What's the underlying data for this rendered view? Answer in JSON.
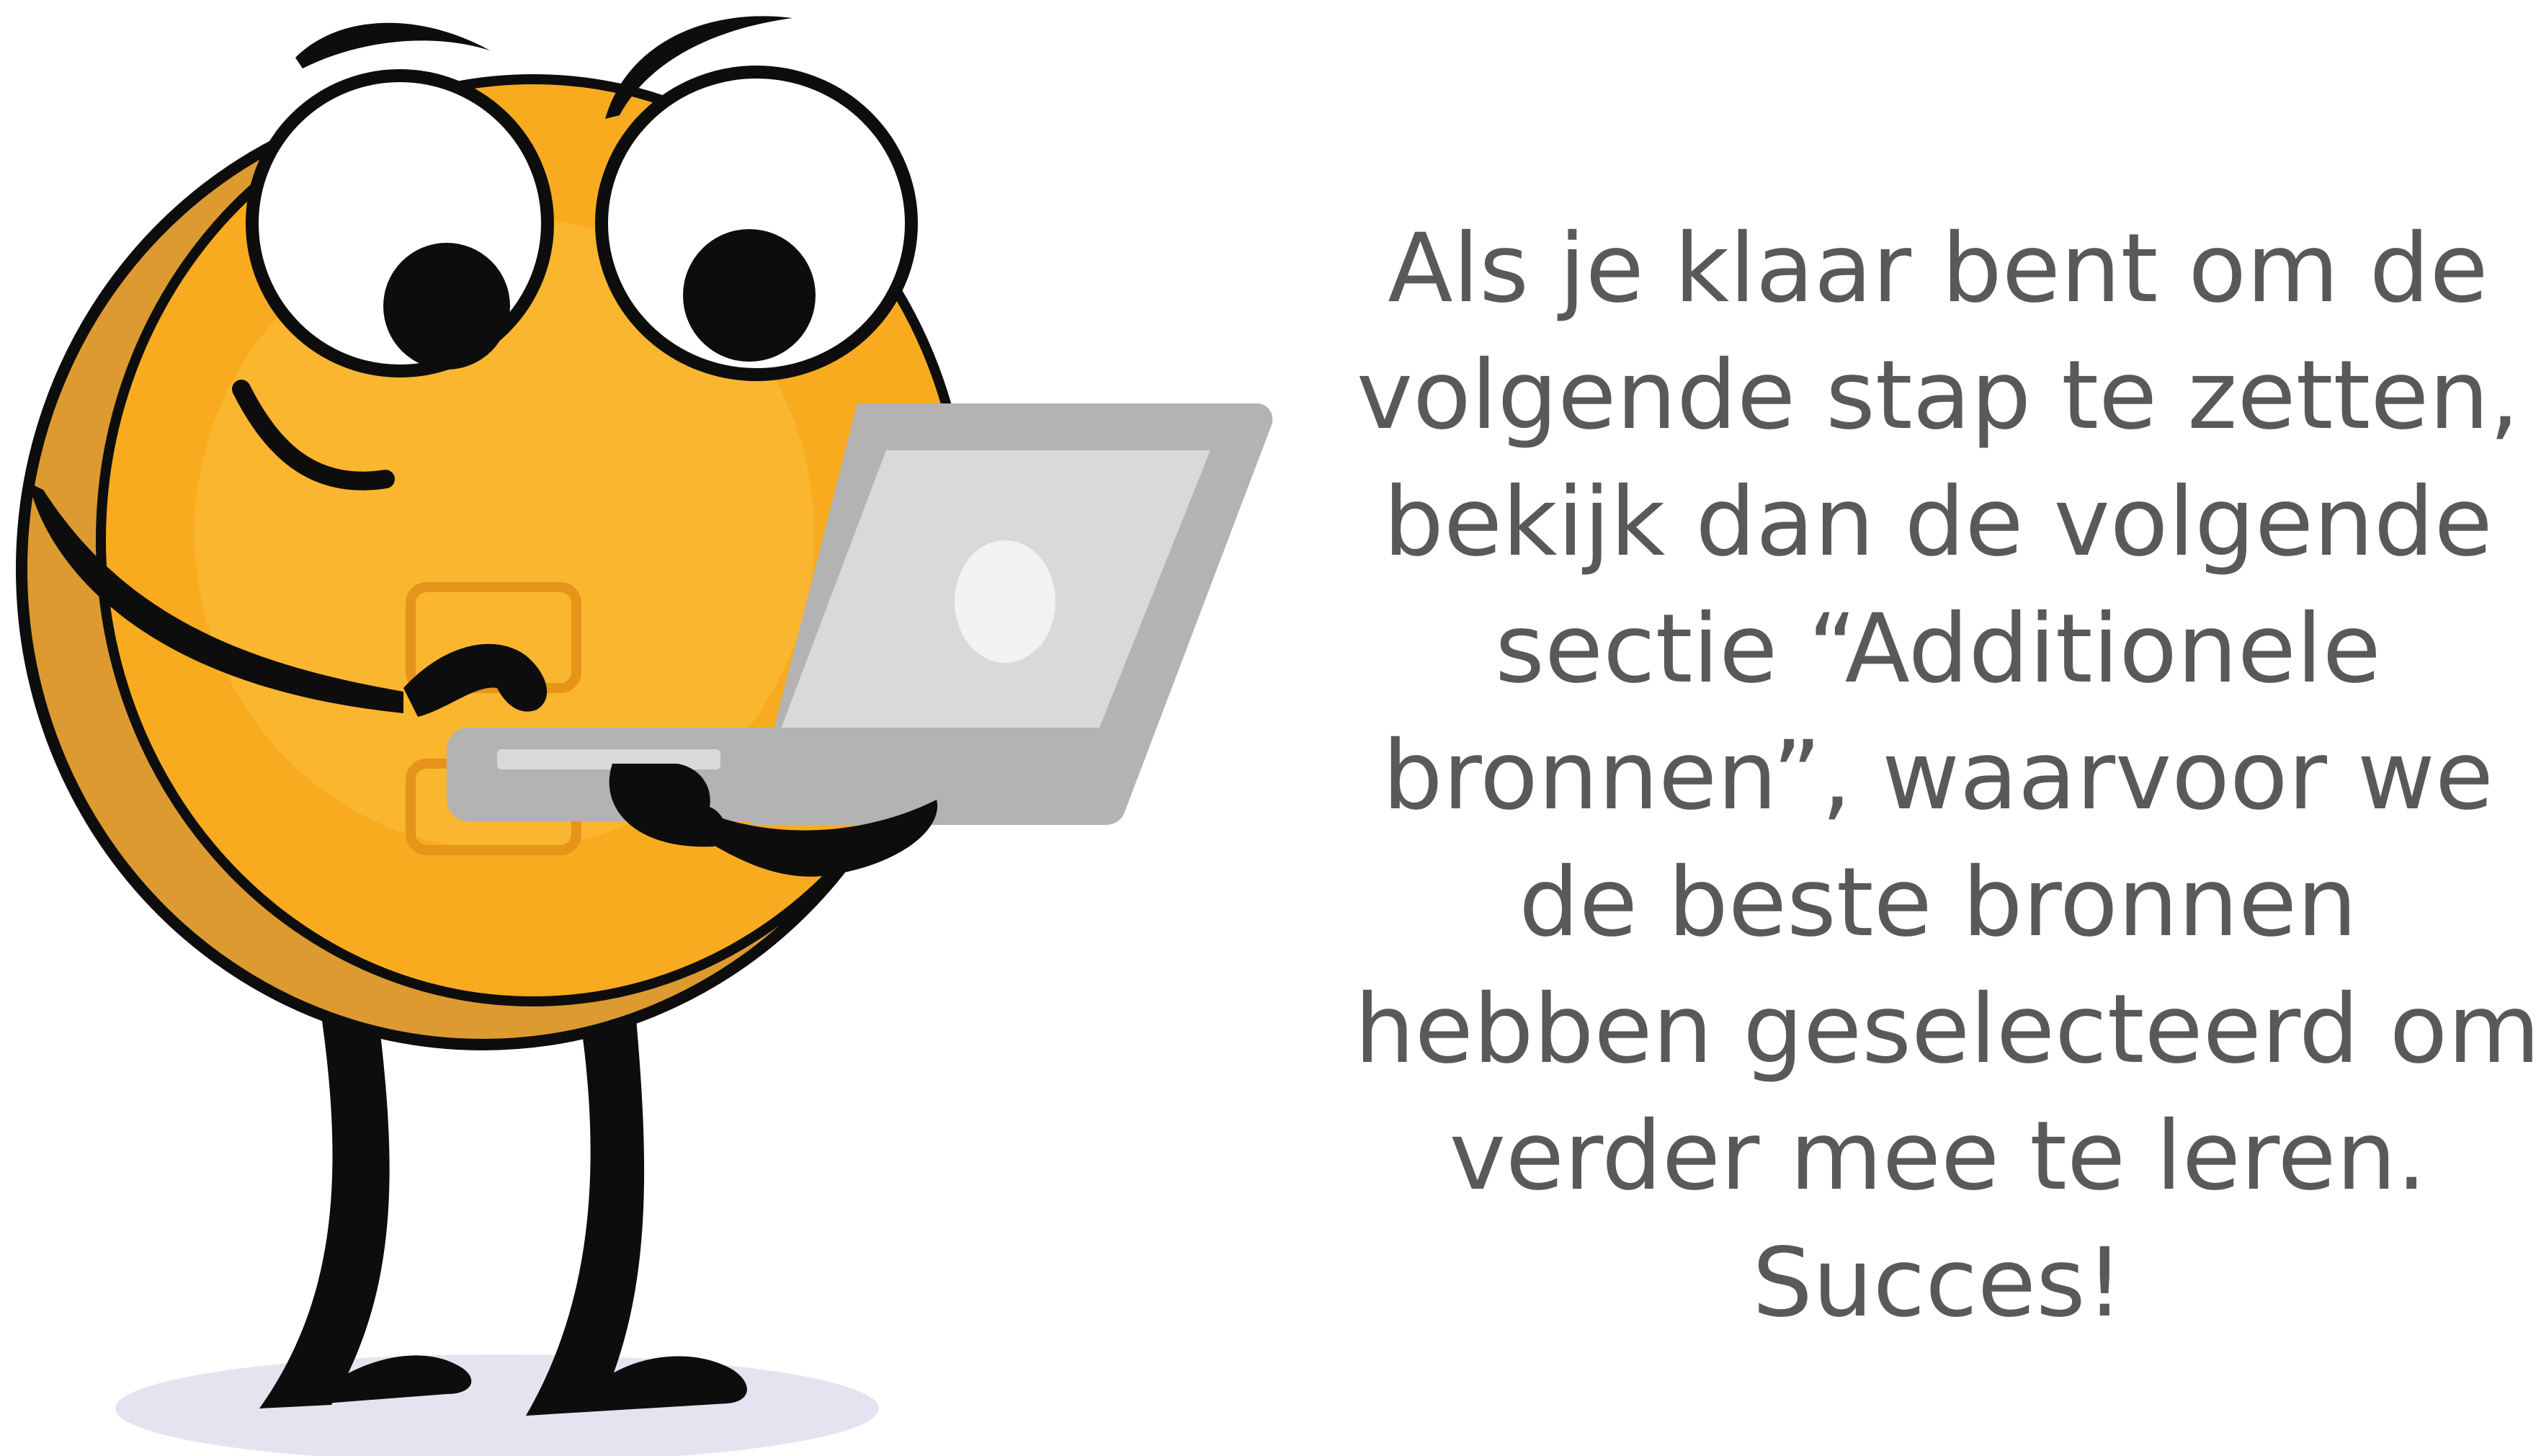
{
  "message": {
    "lines": [
      "Als je klaar bent om de",
      "volgende stap te zetten,",
      "bekijk dan de volgende",
      "sectie “Additionele",
      "bronnen”, waarvoor we",
      "de beste bronnen",
      "hebben geselecteerd om",
      "verder mee te leren.",
      "Succes!"
    ]
  },
  "colors": {
    "text": "#58595b",
    "body_orange": "#f9ab1f",
    "body_shadow": "#dc9a30",
    "outline": "#0d0d0d",
    "laptop_gray": "#b3b3b3",
    "screen_gray": "#d9d9d9",
    "floor_shadow": "#e6e2f0"
  },
  "illustration": {
    "subject": "cartoon-character-with-laptop"
  }
}
